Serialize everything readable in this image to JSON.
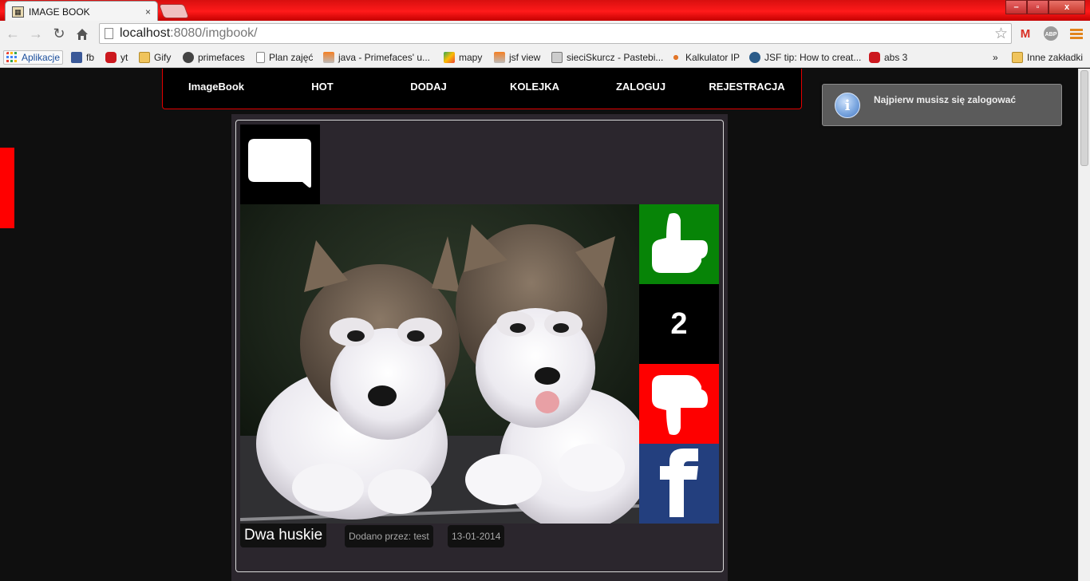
{
  "browser": {
    "tab_title": "IMAGE BOOK",
    "tab_close": "×",
    "url_host": "localhost",
    "url_path": ":8080/imgbook/",
    "window_buttons": [
      "–",
      "▫",
      "x"
    ],
    "bookmarks": [
      {
        "label": "Aplikacje",
        "icon": "apps-icon"
      },
      {
        "label": "fb",
        "icon": "facebook-icon"
      },
      {
        "label": "yt",
        "icon": "youtube-icon"
      },
      {
        "label": "Gify",
        "icon": "folder-icon"
      },
      {
        "label": "primefaces",
        "icon": "primefaces-icon"
      },
      {
        "label": "Plan zajęć",
        "icon": "page-icon"
      },
      {
        "label": "java - Primefaces' u...",
        "icon": "stackoverflow-icon"
      },
      {
        "label": "mapy",
        "icon": "maps-icon"
      },
      {
        "label": "jsf view",
        "icon": "stackoverflow-icon"
      },
      {
        "label": "sieciSkurcz - Pastebi...",
        "icon": "pastebin-icon"
      },
      {
        "label": "Kalkulator IP",
        "icon": "calculator-icon"
      },
      {
        "label": "JSF tip: How to creat...",
        "icon": "globe-icon"
      },
      {
        "label": "abs 3",
        "icon": "youtube-icon"
      }
    ],
    "bookmarks_overflow": "»",
    "other_bookmarks": "Inne zakładki"
  },
  "menu": {
    "items": [
      "ImageBook",
      "HOT",
      "DODAJ",
      "KOLEJKA",
      "ZALOGUJ",
      "REJESTRACJA"
    ]
  },
  "post": {
    "title": "Dwa huskie",
    "author": "Dodano przez: test",
    "date": "13-01-2014",
    "score": "2"
  },
  "notification": {
    "message": "Najpierw musisz się zalogować",
    "icon": "i"
  },
  "colors": {
    "like": "#078407",
    "dislike": "#fe0000",
    "facebook": "#233f7e",
    "menu_border": "#e30000"
  }
}
